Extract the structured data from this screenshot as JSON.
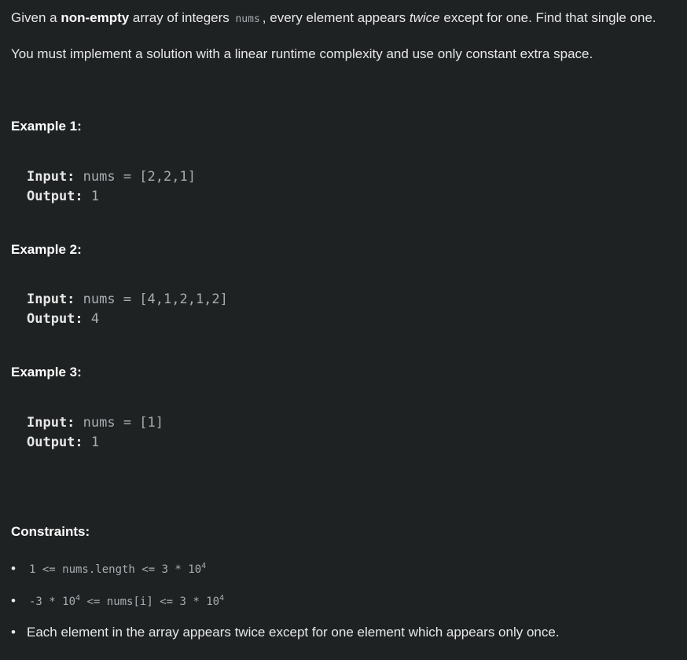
{
  "description": {
    "p1": {
      "t1": "Given a ",
      "bold": "non-empty",
      "t2": " array of integers ",
      "code": "nums",
      "t3": ", every element appears ",
      "italic": "twice",
      "t4": " except for one. Find that single one."
    },
    "p2": "You must implement a solution with a linear runtime complexity and use only constant extra space."
  },
  "examples": [
    {
      "title": "Example 1:",
      "input_label": "Input:",
      "input_value": " nums = [2,2,1]",
      "output_label": "Output:",
      "output_value": " 1"
    },
    {
      "title": "Example 2:",
      "input_label": "Input:",
      "input_value": " nums = [4,1,2,1,2]",
      "output_label": "Output:",
      "output_value": " 4"
    },
    {
      "title": "Example 3:",
      "input_label": "Input:",
      "input_value": " nums = [1]",
      "output_label": "Output:",
      "output_value": " 1"
    }
  ],
  "constraints": {
    "title": "Constraints:",
    "bullet": "•",
    "c1": {
      "a": "1 <= nums.length <= 3 * 10",
      "sup": "4"
    },
    "c2": {
      "a": "-3 * 10",
      "sup1": "4",
      "b": " <= nums[i] <= 3 * 10",
      "sup2": "4"
    },
    "c3": "Each element in the array appears twice except for one element which appears only once."
  }
}
